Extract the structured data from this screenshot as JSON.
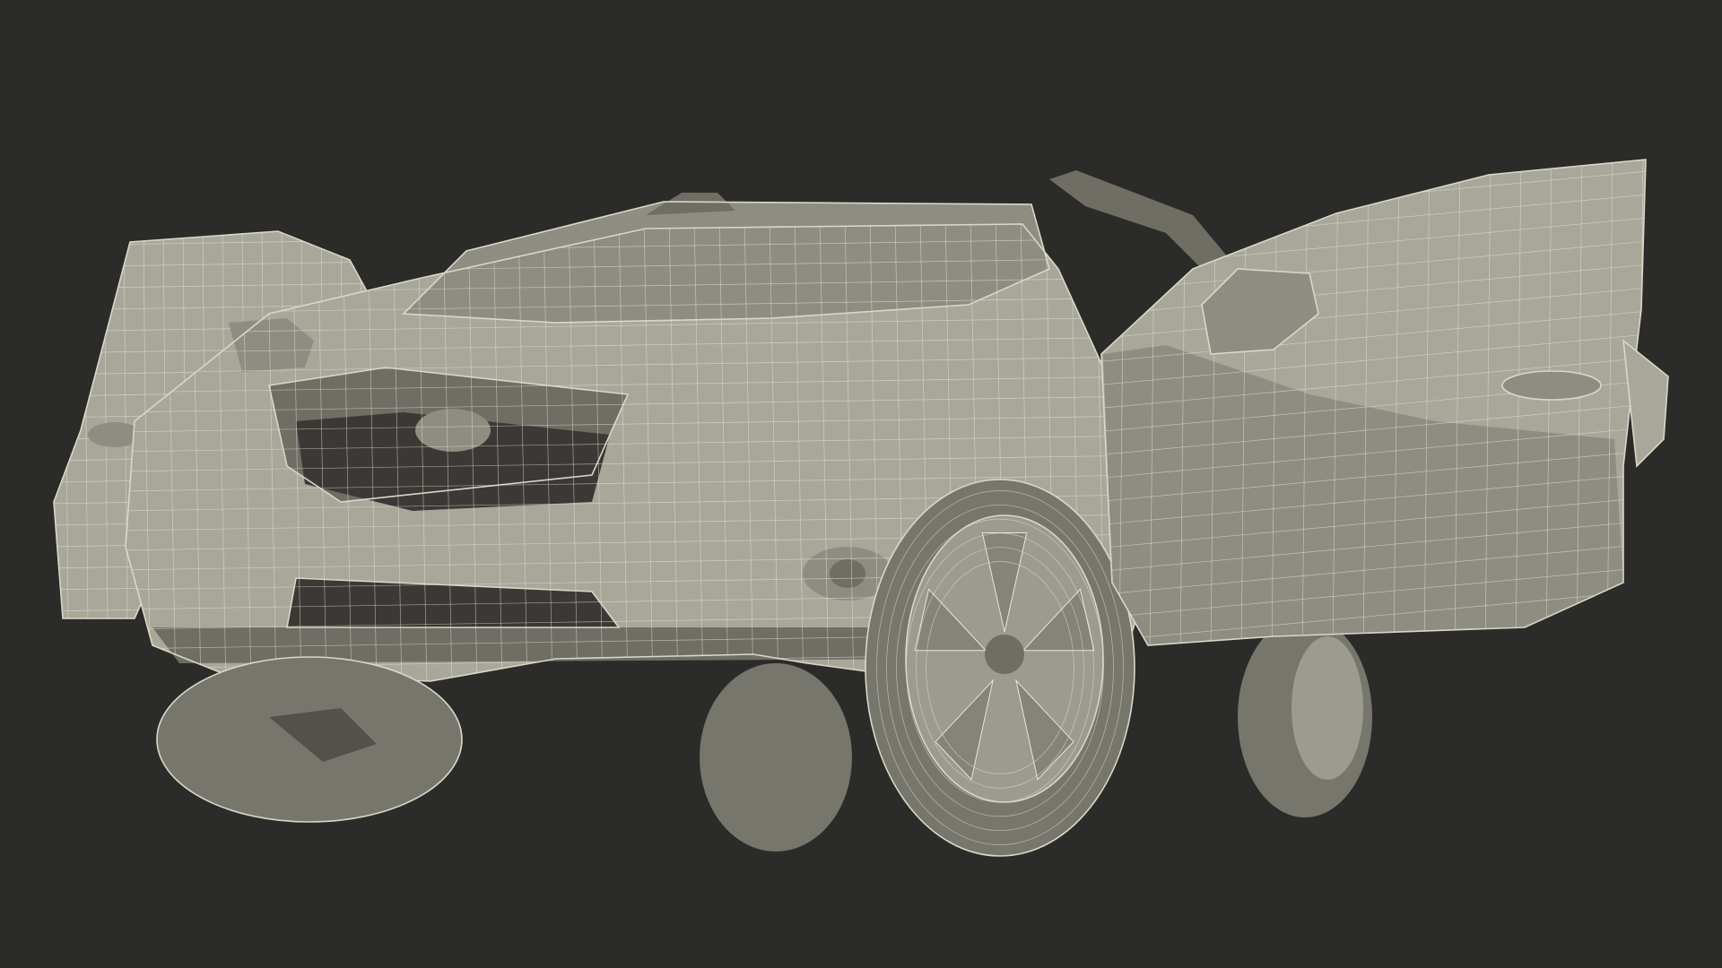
{
  "scene": {
    "subject": "wireframe-suv-doors-open",
    "background_color": "#2b2b29",
    "mesh_fill_color": "#a9a79a",
    "wire_color": "#f2f0e3"
  }
}
